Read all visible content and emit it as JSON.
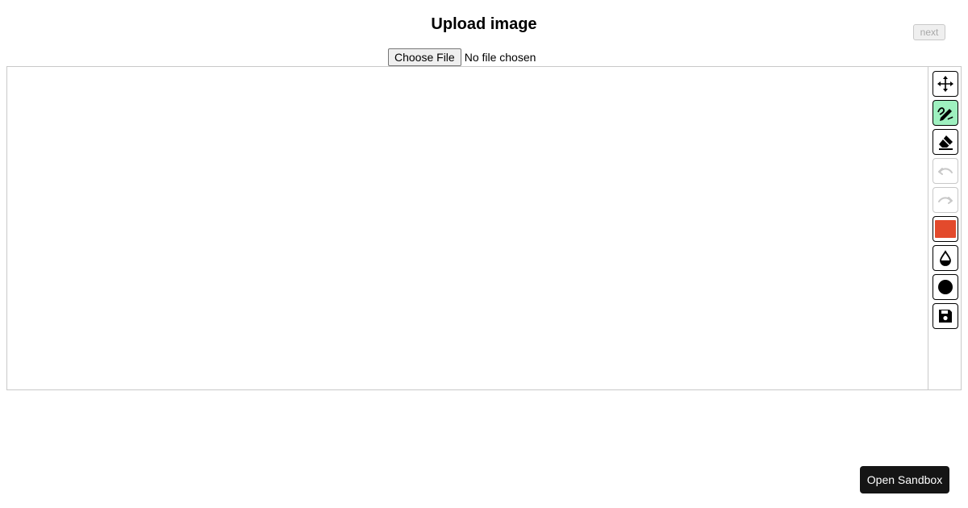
{
  "header": {
    "title": "Upload image",
    "next_label": "next"
  },
  "file_input": {
    "button_label": "Choose File",
    "status": "No file chosen"
  },
  "toolbar": {
    "tools": [
      {
        "name": "move",
        "icon": "move-icon",
        "active": false,
        "disabled": false
      },
      {
        "name": "draw",
        "icon": "pencil-icon",
        "active": true,
        "disabled": false
      },
      {
        "name": "erase",
        "icon": "eraser-icon",
        "active": false,
        "disabled": false
      },
      {
        "name": "undo",
        "icon": "undo-icon",
        "active": false,
        "disabled": true
      },
      {
        "name": "redo",
        "icon": "redo-icon",
        "active": false,
        "disabled": true
      },
      {
        "name": "color",
        "icon": "color-swatch",
        "active": false,
        "disabled": false
      },
      {
        "name": "opacity",
        "icon": "droplet-icon",
        "active": false,
        "disabled": false
      },
      {
        "name": "brush-size",
        "icon": "circle-icon",
        "active": false,
        "disabled": false
      },
      {
        "name": "save",
        "icon": "save-icon",
        "active": false,
        "disabled": false
      }
    ],
    "brush_color": "#e34a2c",
    "active_color": "#9ef0bf"
  },
  "footer": {
    "sandbox_label": "Open Sandbox"
  }
}
